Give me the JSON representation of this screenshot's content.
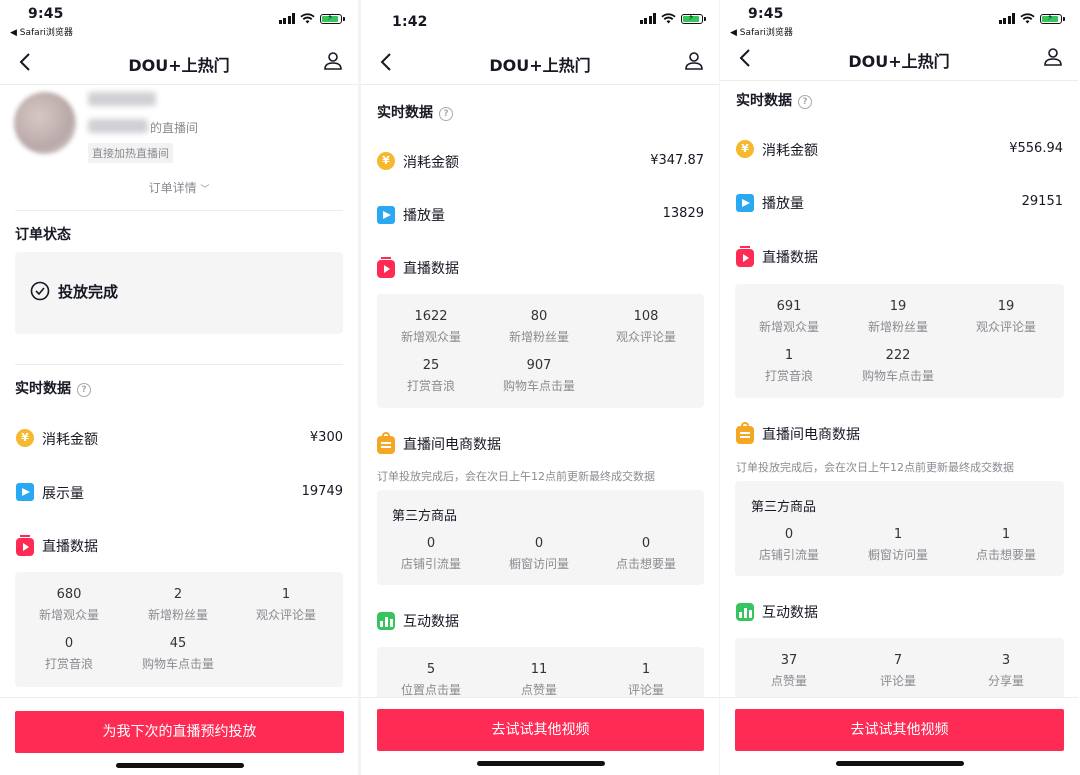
{
  "status_bar": {
    "p1_time": "9:45",
    "p1_back": "◀ Safari浏览器",
    "p2_time": "1:42",
    "p3_time": "9:45",
    "p3_back": "◀ Safari浏览器"
  },
  "nav": {
    "title": "DOU+上热门"
  },
  "icons": [
    "back-chevron-icon",
    "user-icon",
    "help-icon",
    "coin-icon",
    "play-icon",
    "live-tv-icon",
    "shopping-bag-icon",
    "bar-chart-icon",
    "check-circle-icon",
    "chevron-down-icon"
  ],
  "colors": {
    "accent": "#fe2c55",
    "coin": "#f5b82e",
    "play": "#2aa8f2",
    "bag": "#f5a623",
    "chart": "#37c35f",
    "grey_box": "#f5f5f5"
  },
  "panel1": {
    "live_room_suffix": "的直播间",
    "tag": "直接加热直播间",
    "order_detail": "订单详情",
    "order_status_title": "订单状态",
    "order_status": "投放完成",
    "realtime_title": "实时数据",
    "spend_label": "消耗金额",
    "spend_value": "¥300",
    "impressions_label": "展示量",
    "impressions_value": "19749",
    "live_title": "直播数据",
    "live_stats": [
      {
        "value": "680",
        "label": "新增观众量"
      },
      {
        "value": "2",
        "label": "新增粉丝量"
      },
      {
        "value": "1",
        "label": "观众评论量"
      },
      {
        "value": "0",
        "label": "打赏音浪"
      },
      {
        "value": "45",
        "label": "购物车点击量"
      }
    ],
    "cta": "为我下次的直播预约投放"
  },
  "panel2": {
    "realtime_title": "实时数据",
    "spend_label": "消耗金额",
    "spend_value": "¥347.87",
    "plays_label": "播放量",
    "plays_value": "13829",
    "live_title": "直播数据",
    "live_stats": [
      {
        "value": "1622",
        "label": "新增观众量"
      },
      {
        "value": "80",
        "label": "新增粉丝量"
      },
      {
        "value": "108",
        "label": "观众评论量"
      },
      {
        "value": "25",
        "label": "打赏音浪"
      },
      {
        "value": "907",
        "label": "购物车点击量"
      }
    ],
    "ecom_title": "直播间电商数据",
    "ecom_note": "订单投放完成后，会在次日上午12点前更新最终成交数据",
    "third_party_title": "第三方商品",
    "ecom_stats": [
      {
        "value": "0",
        "label": "店铺引流量"
      },
      {
        "value": "0",
        "label": "橱窗访问量"
      },
      {
        "value": "0",
        "label": "点击想要量"
      }
    ],
    "interact_title": "互动数据",
    "interact_stats": [
      {
        "value": "5",
        "label": "位置点击量"
      },
      {
        "value": "11",
        "label": "点赞量"
      },
      {
        "value": "1",
        "label": "评论量"
      }
    ],
    "cta": "去试试其他视频"
  },
  "panel3": {
    "realtime_title": "实时数据",
    "spend_label": "消耗金额",
    "spend_value": "¥556.94",
    "plays_label": "播放量",
    "plays_value": "29151",
    "live_title": "直播数据",
    "live_stats": [
      {
        "value": "691",
        "label": "新增观众量"
      },
      {
        "value": "19",
        "label": "新增粉丝量"
      },
      {
        "value": "19",
        "label": "观众评论量"
      },
      {
        "value": "1",
        "label": "打赏音浪"
      },
      {
        "value": "222",
        "label": "购物车点击量"
      }
    ],
    "ecom_title": "直播间电商数据",
    "ecom_note": "订单投放完成后，会在次日上午12点前更新最终成交数据",
    "third_party_title": "第三方商品",
    "ecom_stats": [
      {
        "value": "0",
        "label": "店铺引流量"
      },
      {
        "value": "1",
        "label": "橱窗访问量"
      },
      {
        "value": "1",
        "label": "点击想要量"
      }
    ],
    "interact_title": "互动数据",
    "interact_stats": [
      {
        "value": "37",
        "label": "点赞量"
      },
      {
        "value": "7",
        "label": "评论量"
      },
      {
        "value": "3",
        "label": "分享量"
      }
    ],
    "cta": "去试试其他视频"
  }
}
